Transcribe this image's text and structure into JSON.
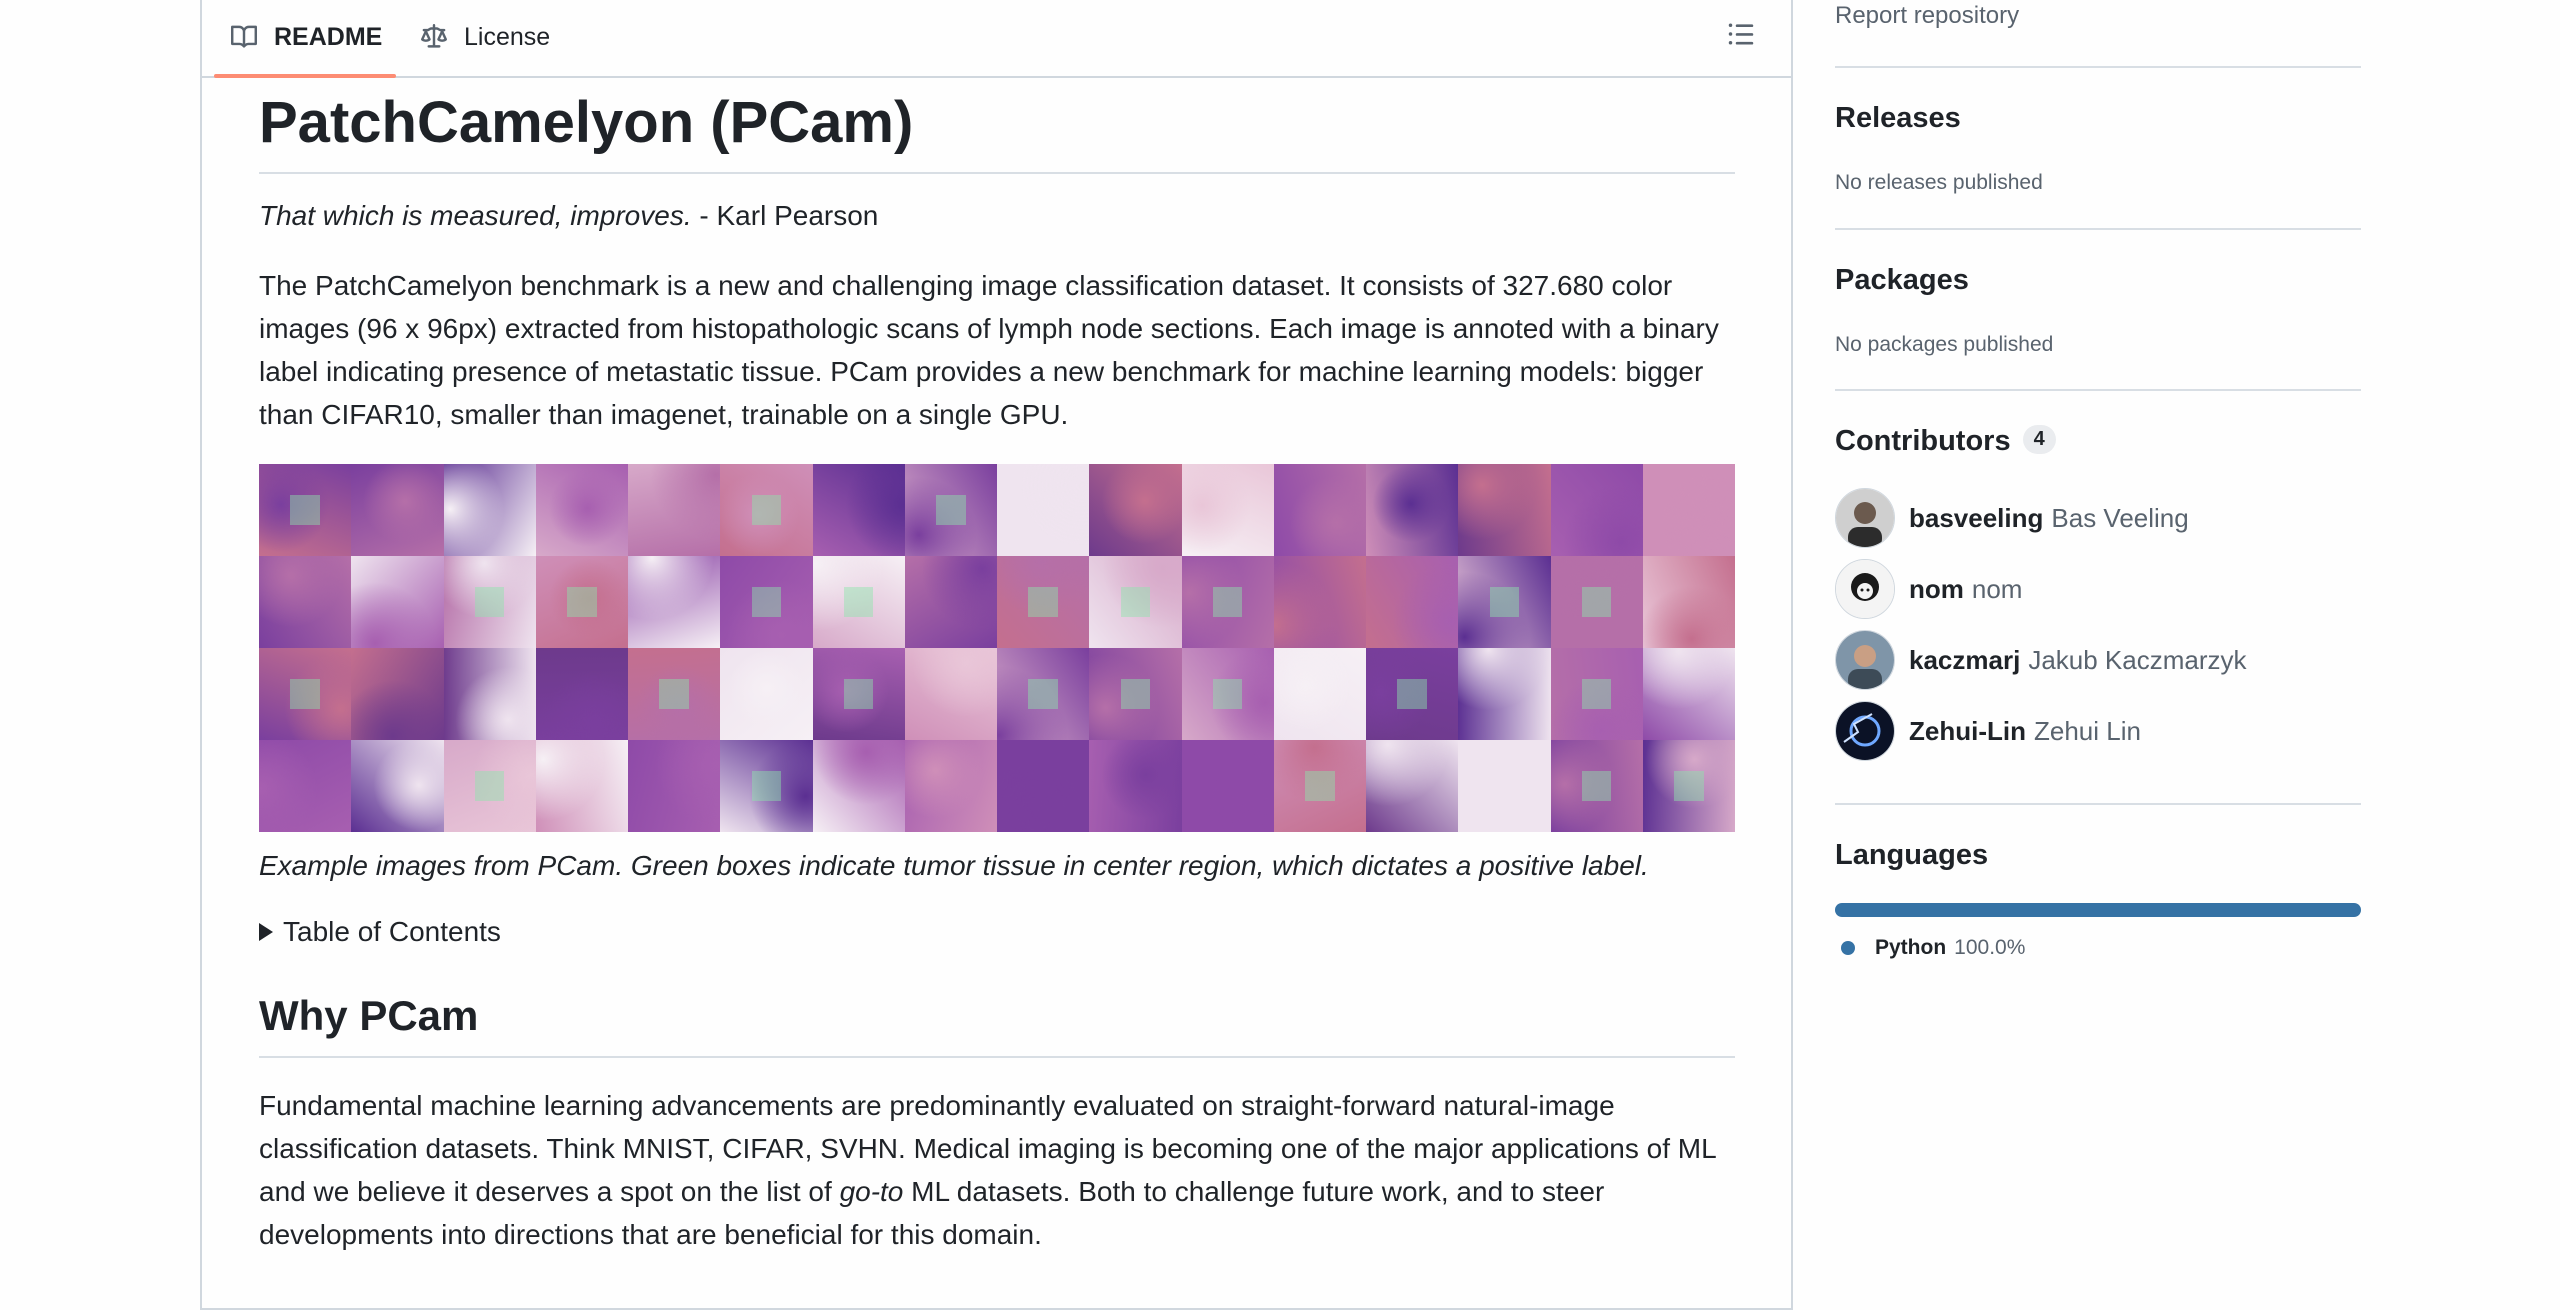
{
  "tabs": {
    "readme": "README",
    "license": "License"
  },
  "readme": {
    "title": "PatchCamelyon (PCam)",
    "quote_text": "That which is measured, improves.",
    "quote_author": " - Karl Pearson",
    "intro": "The PatchCamelyon benchmark is a new and challenging image classification dataset. It consists of 327.680 color images (96 x 96px) extracted from histopathologic scans of lymph node sections. Each image is annoted with a binary label indicating presence of metastatic tissue. PCam provides a new benchmark for machine learning models: bigger than CIFAR10, smaller than imagenet, trainable on a single GPU.",
    "caption": "Example images from PCam. Green boxes indicate tumor tissue in center region, which dictates a positive label.",
    "toc_label": "Table of Contents",
    "why_heading": "Why PCam",
    "why_part1": "Fundamental machine learning advancements are predominantly evaluated on straight-forward natural-image classification datasets. Think MNIST, CIFAR, SVHN. Medical imaging is becoming one of the major applications of ML and we believe it deserves a spot on the list of ",
    "why_em": "go-to",
    "why_part2": " ML datasets. Both to challenge future work, and to steer developments into directions that are beneficial for this domain."
  },
  "sidebar": {
    "report": "Report repository",
    "releases_heading": "Releases",
    "releases_text": "No releases published",
    "packages_heading": "Packages",
    "packages_text": "No packages published",
    "contributors_heading": "Contributors",
    "contributors_count": "4",
    "contributors": [
      {
        "login": "basveeling",
        "name": "Bas Veeling"
      },
      {
        "login": "nom",
        "name": "nom"
      },
      {
        "login": "kaczmarj",
        "name": "Jakub Kaczmarzyk"
      },
      {
        "login": "Zehui-Lin",
        "name": "Zehui Lin"
      }
    ],
    "languages_heading": "Languages",
    "language": {
      "name": "Python",
      "percent": "100.0%",
      "share": 1.0,
      "color": "#3572a5"
    }
  },
  "colors": {
    "accent_tab": "#fd8c73",
    "border": "#d0d7de",
    "muted": "#59636e"
  }
}
